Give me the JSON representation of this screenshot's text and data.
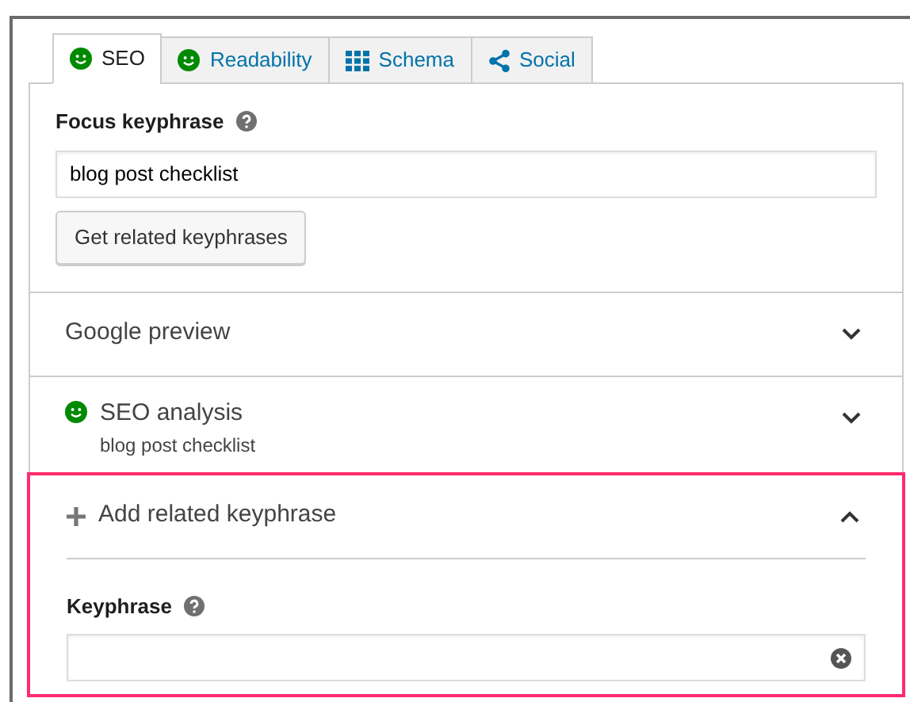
{
  "tabs": [
    {
      "label": "SEO",
      "kind": "score",
      "selected": true
    },
    {
      "label": "Readability",
      "kind": "score",
      "selected": false
    },
    {
      "label": "Schema",
      "kind": "schema",
      "selected": false
    },
    {
      "label": "Social",
      "kind": "social",
      "selected": false
    }
  ],
  "focus_keyphrase": {
    "label": "Focus keyphrase",
    "value": "blog post checklist"
  },
  "related_button": "Get related keyphrases",
  "sections": [
    {
      "title": "Google preview",
      "kind": "plain",
      "expanded": false,
      "highlighted": false
    },
    {
      "title": "SEO analysis",
      "subtitle": "blog post checklist",
      "kind": "status",
      "expanded": false,
      "highlighted": false
    },
    {
      "title": "Add related keyphrase",
      "kind": "add",
      "expanded": true,
      "highlighted": true,
      "field": {
        "label": "Keyphrase"
      }
    }
  ]
}
